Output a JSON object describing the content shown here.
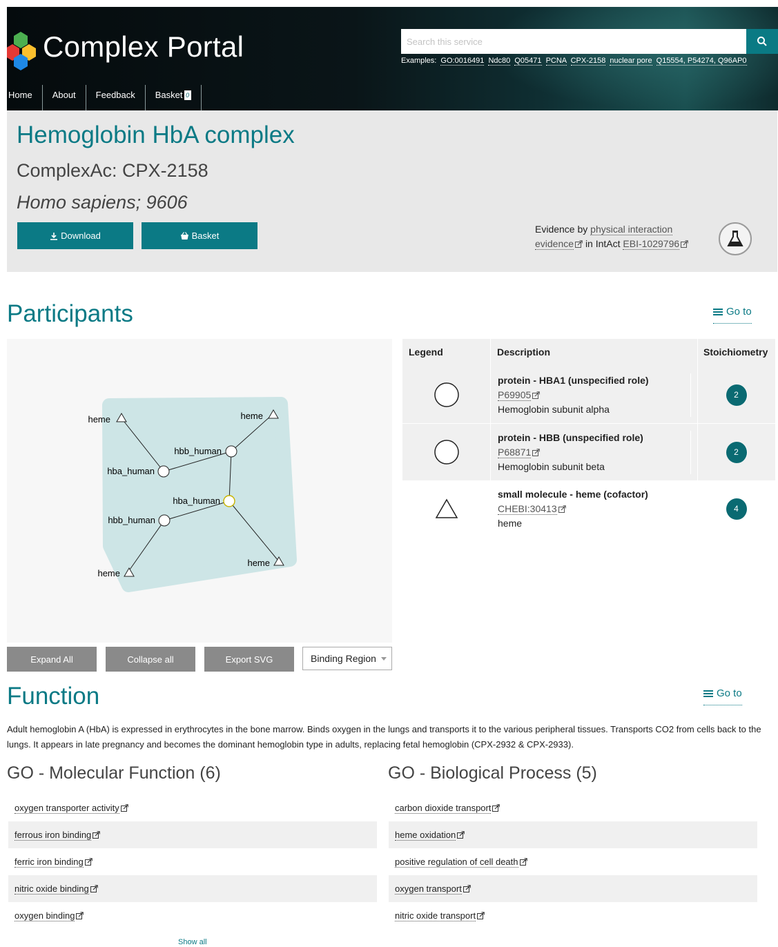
{
  "header": {
    "brand": "Complex Portal",
    "nav": [
      {
        "label": "Home"
      },
      {
        "label": "About"
      },
      {
        "label": "Feedback"
      },
      {
        "label": "Basket",
        "count": "0"
      }
    ],
    "search": {
      "placeholder": "Search this service"
    },
    "examples_label": "Examples:",
    "examples": [
      "GO:0016491",
      "Ndc80",
      "Q05471",
      "PCNA",
      "CPX-2158",
      "nuclear pore",
      "Q15554, P54274, Q96AP0"
    ]
  },
  "complex": {
    "title": "Hemoglobin HbA complex",
    "ac": "ComplexAc: CPX-2158",
    "species": "Homo sapiens; 9606",
    "download_label": "Download",
    "basket_label": "Basket",
    "evidence": {
      "prefix": "Evidence by",
      "link1": "physical interaction evidence",
      "middle": "in IntAct",
      "link2": "EBI-1029796"
    }
  },
  "participants": {
    "title": "Participants",
    "goto": "Go to",
    "network": {
      "nodes": [
        {
          "label": "heme",
          "shape": "triangle"
        },
        {
          "label": "heme",
          "shape": "triangle"
        },
        {
          "label": "hbb_human",
          "shape": "circle"
        },
        {
          "label": "hba_human",
          "shape": "circle"
        },
        {
          "label": "hba_human",
          "shape": "circle"
        },
        {
          "label": "hbb_human",
          "shape": "circle"
        },
        {
          "label": "heme",
          "shape": "triangle"
        },
        {
          "label": "heme",
          "shape": "triangle"
        }
      ]
    },
    "buttons": {
      "expand": "Expand All",
      "collapse": "Collapse all",
      "export": "Export SVG",
      "select": "Binding Region"
    },
    "table": {
      "headers": {
        "legend": "Legend",
        "description": "Description",
        "stoich": "Stoichiometry"
      },
      "rows": [
        {
          "shape": "circle",
          "name": "protein - HBA1 (unspecified role)",
          "id": "P69905",
          "desc": "Hemoglobin subunit alpha",
          "stoich": "2"
        },
        {
          "shape": "circle",
          "name": "protein - HBB (unspecified role)",
          "id": "P68871",
          "desc": "Hemoglobin subunit beta",
          "stoich": "2"
        },
        {
          "shape": "triangle",
          "name": "small molecule - heme (cofactor)",
          "id": "CHEBI:30413",
          "desc": "heme",
          "stoich": "4"
        }
      ]
    }
  },
  "function": {
    "title": "Function",
    "goto": "Go to",
    "text": "Adult hemoglobin A (HbA) is expressed in erythrocytes in the bone marrow. Binds oxygen in the lungs and transports it to the various peripheral tissues. Transports CO2 from cells back to the lungs. It appears in late pregnancy and becomes the dominant hemoglobin type in adults, replacing fetal hemoglobin (CPX-2932 & CPX-2933).",
    "mf_title": "GO - Molecular Function (6)",
    "mf": [
      "oxygen transporter activity",
      "ferrous iron binding",
      "ferric iron binding",
      "nitric oxide binding",
      "oxygen binding"
    ],
    "bp_title": "GO - Biological Process (5)",
    "bp": [
      "carbon dioxide transport",
      "heme oxidation",
      "positive regulation of cell death",
      "oxygen transport",
      "nitric oxide transport"
    ],
    "show_all": "Show all"
  },
  "colors": {
    "brand": "#0b7a85",
    "stoich": "#0a6a72",
    "button_grey": "#8a8a8a",
    "panel": "#e8e8e8"
  }
}
